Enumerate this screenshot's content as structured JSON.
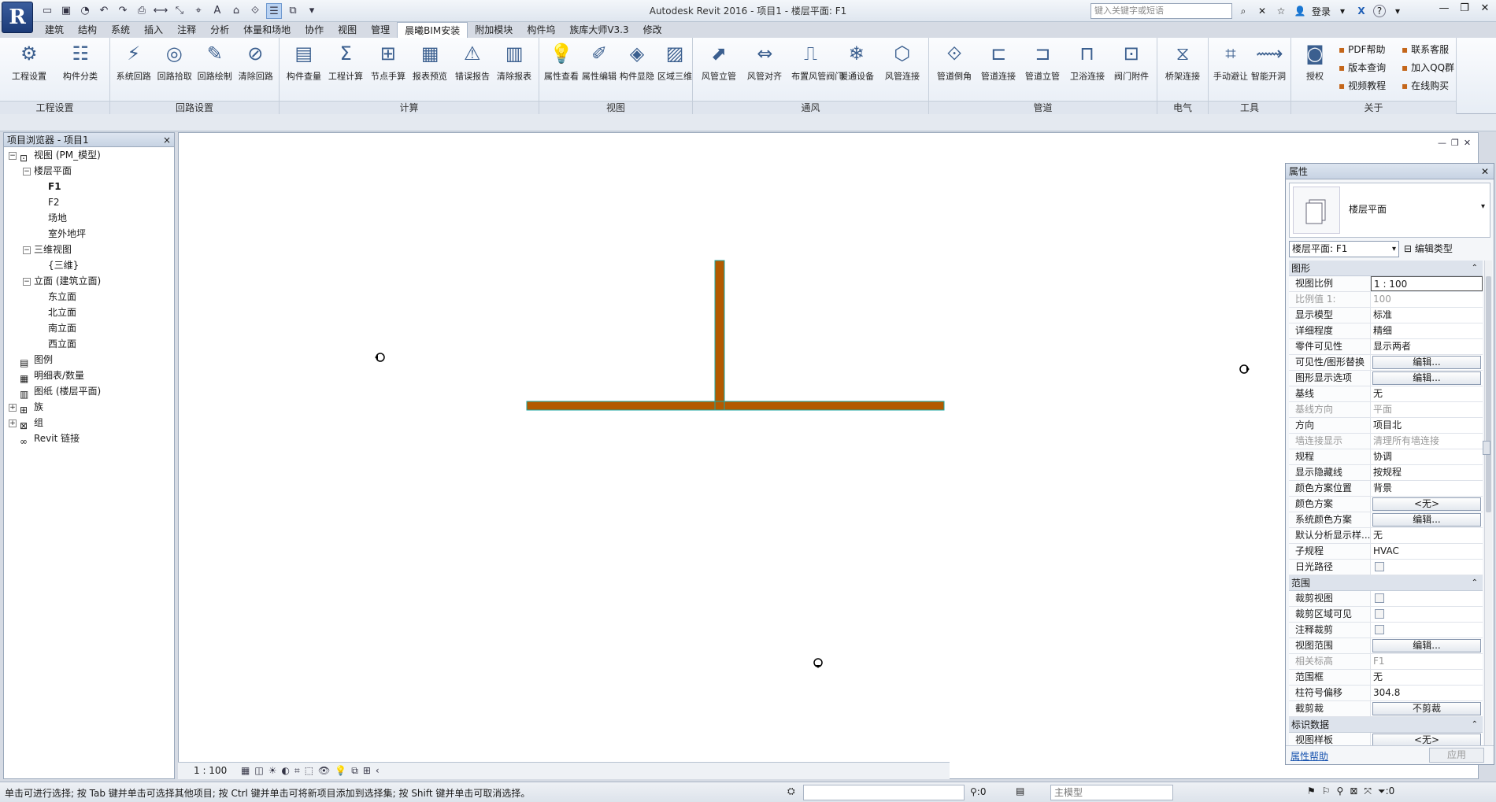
{
  "app": {
    "logo_letter": "R",
    "title": "Autodesk Revit 2016 -    项目1 - 楼层平面: F1",
    "search_placeholder": "键入关键字或短语",
    "login_label": "登录",
    "help_label": "?"
  },
  "menu_tabs": [
    "建筑",
    "结构",
    "系统",
    "插入",
    "注释",
    "分析",
    "体量和场地",
    "协作",
    "视图",
    "管理",
    "晨曦BIM安装",
    "附加模块",
    "构件坞",
    "族库大师V3.3",
    "修改"
  ],
  "active_tab": "晨曦BIM安装",
  "ribbon": {
    "panels": [
      {
        "title": "工程设置",
        "tools": [
          "工程设置",
          "构件分类"
        ]
      },
      {
        "title": "回路设置",
        "tools": [
          "系统回路",
          "回路拾取",
          "回路绘制",
          "清除回路"
        ]
      },
      {
        "title": "计算",
        "tools": [
          "构件查量",
          "工程计算",
          "节点手算",
          "报表预览",
          "错误报告",
          "清除报表"
        ]
      },
      {
        "title": "视图",
        "tools": [
          "属性查看",
          "属性编辑",
          "构件显隐",
          "区域三维"
        ]
      },
      {
        "title": "通风",
        "tools": [
          "风管立管",
          "风管对齐",
          "布置风管阀门",
          "暖通设备",
          "风管连接"
        ]
      },
      {
        "title": "管道",
        "tools": [
          "管道倒角",
          "管道连接",
          "管道立管",
          "卫浴连接",
          "阀门附件"
        ]
      },
      {
        "title": "电气",
        "tools": [
          "桥架连接"
        ]
      },
      {
        "title": "工具",
        "tools": [
          "手动避让",
          "智能开洞"
        ]
      },
      {
        "title": "关于",
        "tools": [
          "授权"
        ],
        "links": [
          "PDF帮助",
          "联系客服",
          "版本查询",
          "加入QQ群",
          "视频教程",
          "在线购买"
        ]
      }
    ]
  },
  "browser": {
    "title": "项目浏览器 - 项目1",
    "close": "×",
    "tree": [
      {
        "label": "视图 (PM_模型)",
        "level": 0,
        "exp": "−",
        "icon": "views-icon"
      },
      {
        "label": "楼层平面",
        "level": 1,
        "exp": "−"
      },
      {
        "label": "F1",
        "level": 2,
        "selected": true
      },
      {
        "label": "F2",
        "level": 2
      },
      {
        "label": "场地",
        "level": 2
      },
      {
        "label": "室外地坪",
        "level": 2
      },
      {
        "label": "三维视图",
        "level": 1,
        "exp": "−"
      },
      {
        "label": "{三维}",
        "level": 2
      },
      {
        "label": "立面 (建筑立面)",
        "level": 1,
        "exp": "−"
      },
      {
        "label": "东立面",
        "level": 2
      },
      {
        "label": "北立面",
        "level": 2
      },
      {
        "label": "南立面",
        "level": 2
      },
      {
        "label": "西立面",
        "level": 2
      },
      {
        "label": "图例",
        "level": 0,
        "icon": "legend-icon"
      },
      {
        "label": "明细表/数量",
        "level": 0,
        "icon": "schedule-icon"
      },
      {
        "label": "图纸 (楼层平面)",
        "level": 0,
        "icon": "sheet-icon"
      },
      {
        "label": "族",
        "level": 0,
        "exp": "+",
        "icon": "family-icon"
      },
      {
        "label": "组",
        "level": 0,
        "exp": "+",
        "icon": "group-icon"
      },
      {
        "label": "Revit 链接",
        "level": 0,
        "icon": "link-icon"
      }
    ]
  },
  "view_bar": {
    "scale": "1 : 100"
  },
  "properties": {
    "title": "属性",
    "type_name": "楼层平面",
    "instance": "楼层平面: F1",
    "edit_type": "编辑类型",
    "groups": [
      {
        "name": "图形",
        "rows": [
          {
            "n": "视图比例",
            "v": "1 : 100",
            "kind": "input"
          },
          {
            "n": "比例值 1:",
            "v": "100",
            "ro": true
          },
          {
            "n": "显示模型",
            "v": "标准"
          },
          {
            "n": "详细程度",
            "v": "精细"
          },
          {
            "n": "零件可见性",
            "v": "显示两者"
          },
          {
            "n": "可见性/图形替换",
            "v": "编辑...",
            "kind": "btn"
          },
          {
            "n": "图形显示选项",
            "v": "编辑...",
            "kind": "btn"
          },
          {
            "n": "基线",
            "v": "无"
          },
          {
            "n": "基线方向",
            "v": "平面",
            "ro": true
          },
          {
            "n": "方向",
            "v": "项目北"
          },
          {
            "n": "墙连接显示",
            "v": "清理所有墙连接",
            "ro": true
          },
          {
            "n": "规程",
            "v": "协调"
          },
          {
            "n": "显示隐藏线",
            "v": "按规程"
          },
          {
            "n": "颜色方案位置",
            "v": "背景"
          },
          {
            "n": "颜色方案",
            "v": "<无>",
            "kind": "btn"
          },
          {
            "n": "系统颜色方案",
            "v": "编辑...",
            "kind": "btn"
          },
          {
            "n": "默认分析显示样...",
            "v": "无"
          },
          {
            "n": "子规程",
            "v": "HVAC"
          },
          {
            "n": "日光路径",
            "v": "",
            "kind": "chk"
          }
        ]
      },
      {
        "name": "范围",
        "rows": [
          {
            "n": "裁剪视图",
            "v": "",
            "kind": "chk"
          },
          {
            "n": "裁剪区域可见",
            "v": "",
            "kind": "chk"
          },
          {
            "n": "注释裁剪",
            "v": "",
            "kind": "chk"
          },
          {
            "n": "视图范围",
            "v": "编辑...",
            "kind": "btn"
          },
          {
            "n": "相关标高",
            "v": "F1",
            "ro": true
          },
          {
            "n": "范围框",
            "v": "无"
          },
          {
            "n": "柱符号偏移",
            "v": "304.8"
          },
          {
            "n": "截剪裁",
            "v": "不剪裁",
            "kind": "btn"
          }
        ]
      },
      {
        "name": "标识数据",
        "rows": [
          {
            "n": "视图样板",
            "v": "<无>",
            "kind": "btn"
          }
        ]
      }
    ],
    "help": "属性帮助",
    "apply": "应用"
  },
  "status": {
    "text": "单击可进行选择; 按 Tab 键并单击可选择其他项目; 按 Ctrl 键并单击可将新项目添加到选择集; 按 Shift 键并单击可取消选择。",
    "filter_count": ":0",
    "model": "主模型",
    "select_count": ":0"
  },
  "colors": {
    "duct": "#b35a00",
    "duct_edge": "#1aa6a0"
  }
}
